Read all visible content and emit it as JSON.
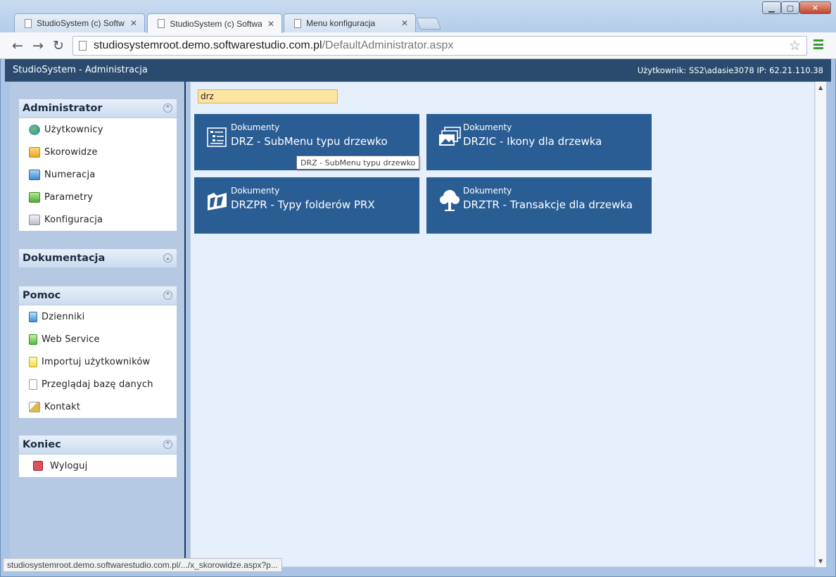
{
  "browser": {
    "tabs": [
      {
        "label": "StudioSystem (c) Software",
        "active": false
      },
      {
        "label": "StudioSystem (c) Software",
        "active": true
      },
      {
        "label": "Menu konfiguracja",
        "active": false
      }
    ],
    "url_host": "studiosystemroot.demo.softwarestudio.com.pl",
    "url_path": "/DefaultAdministrator.aspx",
    "status_url": "studiosystemroot.demo.softwarestudio.com.pl/.../x_skorowidze.aspx?p..."
  },
  "app": {
    "title": "StudioSystem - Administracja",
    "user_info": "Użytkownik: SS2\\adasie3078 IP: 62.21.110.38"
  },
  "sidebar": {
    "panels": [
      {
        "title": "Administrator",
        "items": [
          "Użytkownicy",
          "Skorowidze",
          "Numeracja",
          "Parametry",
          "Konfiguracja"
        ]
      },
      {
        "title": "Dokumentacja",
        "items": []
      },
      {
        "title": "Pomoc",
        "items": [
          "Dzienniki",
          "Web Service",
          "Importuj użytkowników",
          "Przeglądaj bazę danych",
          "Kontakt"
        ]
      },
      {
        "title": "Koniec",
        "items": [
          "Wyloguj"
        ]
      }
    ]
  },
  "content": {
    "search_value": "drz",
    "tiles": [
      {
        "category": "Dokumenty",
        "title": "DRZ - SubMenu typu drzewko",
        "icon": "tree-list-icon"
      },
      {
        "category": "Dokumenty",
        "title": "DRZIC - Ikony dla drzewka",
        "icon": "stacked-images-icon"
      },
      {
        "category": "Dokumenty",
        "title": "DRZPR - Typy folderów PRX",
        "icon": "folder-types-icon"
      },
      {
        "category": "Dokumenty",
        "title": "DRZTR - Transakcje dla drzewka",
        "icon": "tree-icon"
      }
    ],
    "tooltip": "DRZ - SubMenu typu drzewko"
  },
  "colors": {
    "header_bg": "#2a4b6e",
    "tile_bg": "#2a5d94",
    "search_bg": "#ffe3a0"
  }
}
